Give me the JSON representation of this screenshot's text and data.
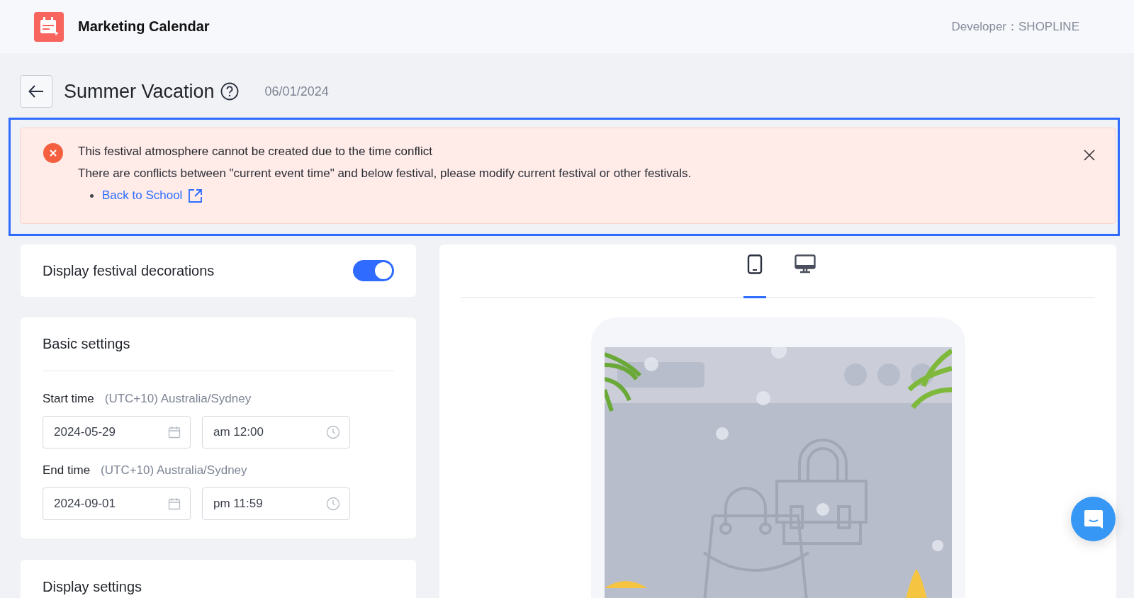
{
  "header": {
    "app_name": "Marketing Calendar",
    "developer": "Developer：SHOPLINE"
  },
  "page": {
    "title": "Summer Vacation",
    "date": "06/01/2024"
  },
  "alert": {
    "highlighted": true,
    "title": "This festival atmosphere cannot be created due to the time conflict",
    "message": "There are conflicts between \"current event time\" and below festival, please modify current festival or other festivals.",
    "links": [
      "Back to School"
    ]
  },
  "decorations": {
    "label": "Display festival decorations",
    "on": true
  },
  "basic_settings": {
    "title": "Basic settings",
    "groups": [
      {
        "label": "Start time",
        "timezone": "(UTC+10) Australia/Sydney",
        "fields": [
          {
            "kind": "date",
            "value": "2024-05-29"
          },
          {
            "kind": "time",
            "value": "am 12:00"
          }
        ]
      },
      {
        "label": "End time",
        "timezone": "(UTC+10) Australia/Sydney",
        "fields": [
          {
            "kind": "date",
            "value": "2024-09-01"
          },
          {
            "kind": "time",
            "value": "pm 11:59"
          }
        ]
      }
    ]
  },
  "display_settings": {
    "title": "Display settings"
  },
  "preview": {
    "tabs": [
      {
        "kind": "mobile",
        "selected": true
      },
      {
        "kind": "desktop",
        "selected": false
      }
    ]
  }
}
